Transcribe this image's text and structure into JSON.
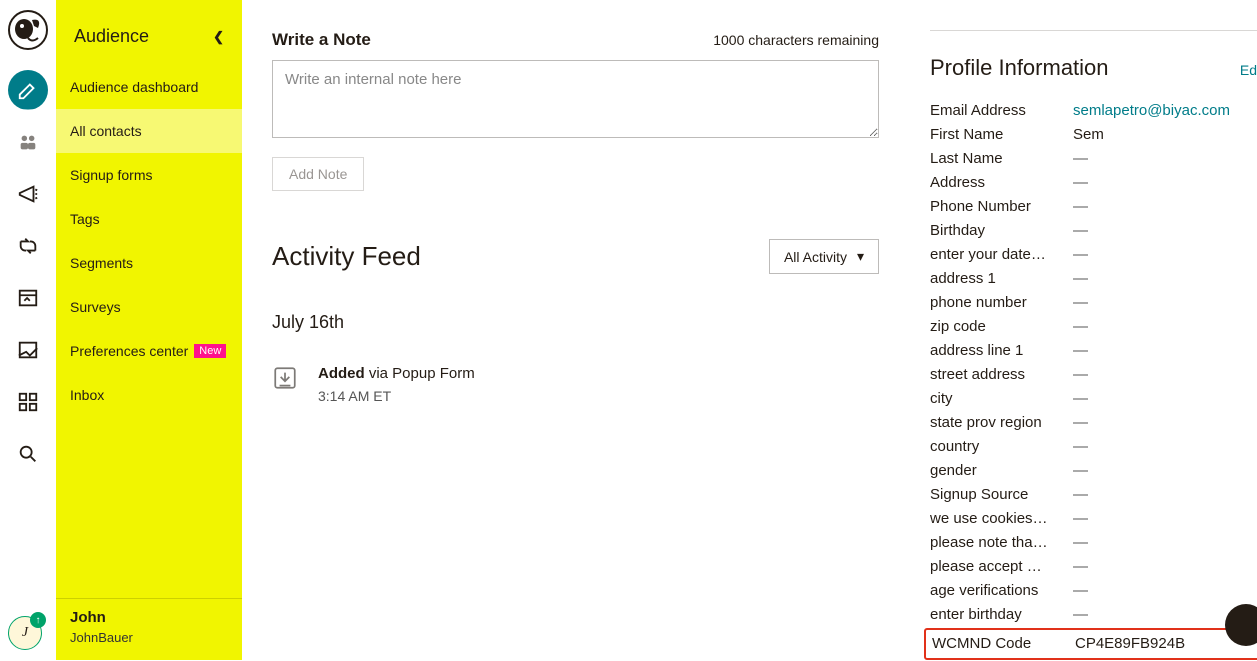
{
  "sidebar": {
    "title": "Audience",
    "items": [
      {
        "label": "Audience dashboard"
      },
      {
        "label": "All contacts"
      },
      {
        "label": "Signup forms"
      },
      {
        "label": "Tags"
      },
      {
        "label": "Segments"
      },
      {
        "label": "Surveys"
      },
      {
        "label": "Preferences center",
        "badge": "New"
      },
      {
        "label": "Inbox"
      }
    ],
    "footer": {
      "name": "John",
      "sub": "JohnBauer"
    },
    "avatar_initial": "J"
  },
  "note": {
    "title": "Write a Note",
    "remaining": "1000 characters remaining",
    "placeholder": "Write an internal note here",
    "button": "Add Note"
  },
  "feed": {
    "title": "Activity Feed",
    "filter": "All Activity",
    "date": "July 16th",
    "items": [
      {
        "action": "Added",
        "via": " via Popup Form",
        "time": "3:14 AM ET"
      }
    ]
  },
  "profile": {
    "title": "Profile Information",
    "edit": "Ed",
    "fields": [
      {
        "label": "Email Address",
        "value": "semlapetro@biyac.com",
        "link": true
      },
      {
        "label": "First Name",
        "value": "Sem"
      },
      {
        "label": "Last Name",
        "value": "—",
        "empty": true
      },
      {
        "label": "Address",
        "value": "—",
        "empty": true
      },
      {
        "label": "Phone Number",
        "value": "—",
        "empty": true
      },
      {
        "label": "Birthday",
        "value": "—",
        "empty": true
      },
      {
        "label": "enter your date…",
        "value": "—",
        "empty": true
      },
      {
        "label": "address 1",
        "value": "—",
        "empty": true
      },
      {
        "label": "phone number",
        "value": "—",
        "empty": true
      },
      {
        "label": "zip code",
        "value": "—",
        "empty": true
      },
      {
        "label": "address line 1",
        "value": "—",
        "empty": true
      },
      {
        "label": "street address",
        "value": "—",
        "empty": true
      },
      {
        "label": "city",
        "value": "—",
        "empty": true
      },
      {
        "label": "state prov region",
        "value": "—",
        "empty": true
      },
      {
        "label": "country",
        "value": "—",
        "empty": true
      },
      {
        "label": "gender",
        "value": "—",
        "empty": true
      },
      {
        "label": "Signup Source",
        "value": "—",
        "empty": true
      },
      {
        "label": "we use cookies…",
        "value": "—",
        "empty": true
      },
      {
        "label": "please note tha…",
        "value": "—",
        "empty": true
      },
      {
        "label": "please accept …",
        "value": "—",
        "empty": true
      },
      {
        "label": "age verifications",
        "value": "—",
        "empty": true
      },
      {
        "label": "enter birthday",
        "value": "—",
        "empty": true
      },
      {
        "label": "WCMND Code",
        "value": "CP4E89FB924B",
        "highlight": true
      }
    ]
  }
}
